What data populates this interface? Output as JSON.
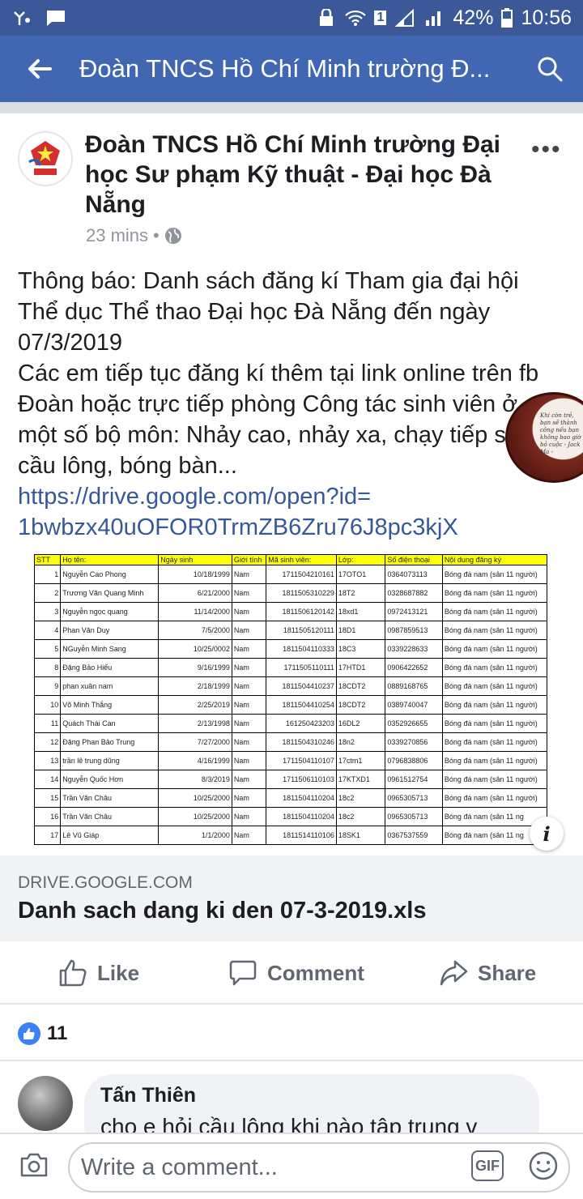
{
  "status": {
    "battery": "42%",
    "time": "10:56",
    "sim": "1"
  },
  "app_bar": {
    "title": "Đoàn TNCS Hồ Chí Minh trường Đ..."
  },
  "post": {
    "author": "Đoàn TNCS Hồ Chí Minh trường Đại học Sư phạm Kỹ thuật - Đại học Đà Nẵng",
    "time": "23 mins",
    "lines": [
      "Thông báo: Danh sách đăng kí Tham gia đại hội",
      "Thể dục Thể thao Đại học Đà Nẵng đến ngày",
      "07/3/2019",
      "Các em tiếp tục đăng kí thêm tại link online trên fb",
      "Đoàn hoặc trực tiếp phòng Công tác sinh viên ở",
      "một số bộ môn: Nhảy cao, nhảy xa, chạy tiếp s",
      "cầu lông, bóng bàn..."
    ],
    "link_line1": "https://drive.google.com/open?id=",
    "link_line2": "1bwbzx40uOFOR0TrmZB6Zru76J8pc3kjX"
  },
  "float_ad": {
    "text": "Khi còn trẻ, bạn sẽ thành công nếu bạn không bao giờ bỏ cuộc - Jack Ma -"
  },
  "sheet": {
    "headers": [
      "STT",
      "Họ tên:",
      "Ngày sinh",
      "Giới tính",
      "Mã sinh viên:",
      "Lớp:",
      "Số điện thoại",
      "Nội dung đăng ký"
    ],
    "rows": [
      [
        "1",
        "Nguyễn Cao Phong",
        "10/18/1999",
        "Nam",
        "1711504210161",
        "17OTO1",
        "0364073113",
        "Bóng đá nam (sân 11 người)"
      ],
      [
        "2",
        "Trương Văn Quang Minh",
        "6/21/2000",
        "Nam",
        "1811505310229",
        "18T2",
        "0328687882",
        "Bóng đá nam (sân 11 người)"
      ],
      [
        "3",
        "Nguyễn ngọc quang",
        "11/14/2000",
        "Nam",
        "1811506120142",
        "18xd1",
        "0972413121",
        "Bóng đá nam (sân 11 người)"
      ],
      [
        "4",
        "Phan Văn Duy",
        "7/5/2000",
        "Nam",
        "1811505120111",
        "18D1",
        "0987859513",
        "Bóng đá nam (sân 11 người)"
      ],
      [
        "5",
        "NGuyễn Minh Sang",
        "10/25/0002",
        "Nam",
        "1811504110333",
        "18C3",
        "0339228633",
        "Bóng đá nam (sân 11 người)"
      ],
      [
        "8",
        "Đặng Bảo Hiếu",
        "9/16/1999",
        "Nam",
        "1711505110111",
        "17HTD1",
        "0906422652",
        "Bóng đá nam (sân 11 người)"
      ],
      [
        "9",
        "phan xuân nam",
        "2/18/1999",
        "Nam",
        "1811504410237",
        "18CDT2",
        "0889168765",
        "Bóng đá nam (sân 11 người)"
      ],
      [
        "10",
        "Võ Minh Thắng",
        "2/25/2019",
        "Nam",
        "1811504410254",
        "18CDT2",
        "0389740047",
        "Bóng đá nam (sân 11 người)"
      ],
      [
        "11",
        "Quách Thái Can",
        "2/13/1998",
        "Nam",
        "161250423203",
        "16DL2",
        "0352926655",
        "Bóng đá nam (sân 11 người)"
      ],
      [
        "12",
        "Đặng Phan Bảo Trung",
        "7/27/2000",
        "Nam",
        "1811504310246",
        "18n2",
        "0339270856",
        "Bóng đá nam (sân 11 người)"
      ],
      [
        "13",
        "trần lê trung dũng",
        "4/16/1999",
        "Nam",
        "1711504110107",
        "17ctm1",
        "0796838806",
        "Bóng đá nam (sân 11 người)"
      ],
      [
        "14",
        "Nguyễn Quốc Hơn",
        "8/3/2019",
        "Nam",
        "1711506110103",
        "17KTXD1",
        "0961512754",
        "Bóng đá nam (sân 11 người)"
      ],
      [
        "15",
        "Trần Văn Châu",
        "10/25/2000",
        "Nam",
        "1811504110204",
        "18c2",
        "0965305713",
        "Bóng đá nam (sân 11 người)"
      ],
      [
        "16",
        "Trần Văn Châu",
        "10/25/2000",
        "Nam",
        "1811504110204",
        "18c2",
        "0965305713",
        "Bóng đá nam (sân 11 ng"
      ],
      [
        "17",
        "Lê Vũ Giáp",
        "1/1/2000",
        "Nam",
        "1811514110106",
        "18SK1",
        "0367537559",
        "Bóng đá nam (sân 11 ng"
      ]
    ]
  },
  "link_preview": {
    "domain": "DRIVE.GOOGLE.COM",
    "file": "Danh sach dang ki den 07-3-2019.xls"
  },
  "actions": {
    "like": "Like",
    "comment": "Comment",
    "share": "Share"
  },
  "reactions": {
    "count": "11"
  },
  "comment": {
    "name": "Tấn Thiên",
    "text": "cho e hỏi cầu lông khi nào tập trung v"
  },
  "composer": {
    "placeholder": "Write a comment...",
    "gif": "GIF"
  },
  "colors": {
    "header": "#4267b2",
    "status_bar": "#3b5998",
    "link": "#365899",
    "sheet_header": "#ffff00"
  }
}
